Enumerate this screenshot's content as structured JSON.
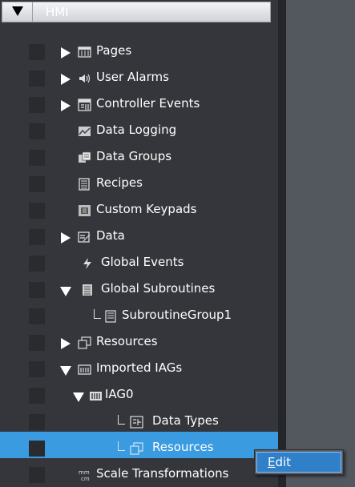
{
  "tree": {
    "root_label": "HMI",
    "items": [
      {
        "label": "Pages"
      },
      {
        "label": "User Alarms"
      },
      {
        "label": "Controller Events"
      },
      {
        "label": "Data Logging"
      },
      {
        "label": "Data Groups"
      },
      {
        "label": "Recipes"
      },
      {
        "label": "Custom Keypads"
      },
      {
        "label": "Data"
      },
      {
        "label": "Global Events"
      },
      {
        "label": "Global Subroutines"
      },
      {
        "label": "SubroutineGroup1"
      },
      {
        "label": "Resources"
      },
      {
        "label": "Imported IAGs"
      },
      {
        "label": "IAG0"
      },
      {
        "label": "Data Types"
      },
      {
        "label": "Resources"
      },
      {
        "label": "Scale Transformations"
      }
    ]
  },
  "context_menu": {
    "items": [
      {
        "label_first": "E",
        "label_rest": "dit"
      }
    ]
  },
  "colors": {
    "panel_bg": "#34363b",
    "selection": "#3a9be0",
    "menu_highlight": "#2f7fc9"
  }
}
